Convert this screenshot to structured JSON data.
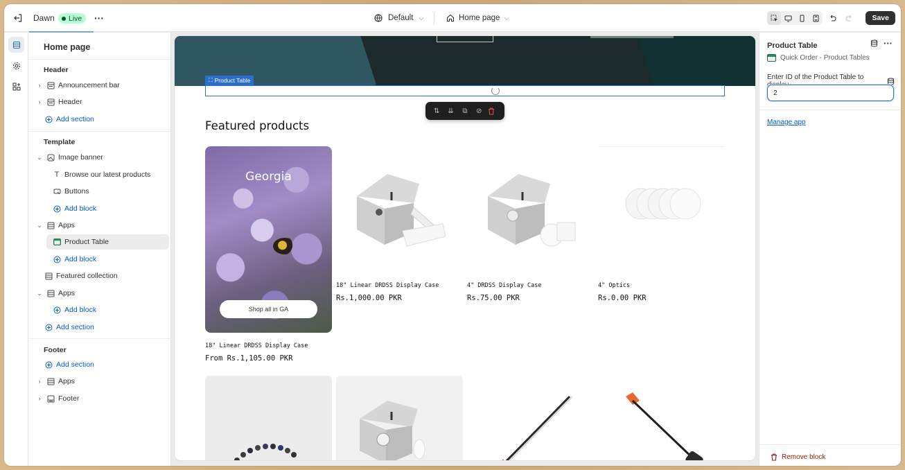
{
  "topbar": {
    "theme_name": "Dawn",
    "live_label": "Live",
    "template_label": "Default",
    "page_label": "Home page",
    "save_label": "Save"
  },
  "sidebar": {
    "title": "Home page",
    "header_group": "Header",
    "announcement_bar": "Announcement bar",
    "header_section": "Header",
    "add_section_1": "Add section",
    "template_group": "Template",
    "image_banner": "Image banner",
    "browse_block": "Browse our latest products",
    "buttons_block": "Buttons",
    "add_block_1": "Add block",
    "apps_1": "Apps",
    "product_table": "Product Table",
    "add_block_2": "Add block",
    "featured_collection": "Featured collection",
    "apps_2": "Apps",
    "add_block_3": "Add block",
    "add_section_2": "Add section",
    "footer_group": "Footer",
    "add_section_3": "Add section",
    "apps_3": "Apps",
    "footer_section": "Footer"
  },
  "preview": {
    "product_table_tag": "Product Table",
    "featured_title": "Featured products",
    "georgia_text": "Georgia",
    "shop_button": "Shop all in GA",
    "products": [
      {
        "title": "18\" Linear DRDSS Display Case",
        "price": "From Rs.1,105.00 PKR"
      },
      {
        "title": "18\" Linear DRDSS Display Case",
        "price": "Rs.1,000.00 PKR"
      },
      {
        "title": "4\" DRDSS Display Case",
        "price": "Rs.75.00 PKR"
      },
      {
        "title": "4\" Optics",
        "price": "Rs.0.00 PKR"
      }
    ]
  },
  "rpanel": {
    "title": "Product Table",
    "app_name": "Quick Order - Product Tables",
    "field_label": "Enter ID of the Product Table to display",
    "field_value": "2",
    "manage_app": "Manage app",
    "remove_block": "Remove block"
  },
  "colors": {
    "accent": "#2c6ecb",
    "link": "#005bd3",
    "live_badge": "#b4fed2",
    "danger": "#e34d4d"
  }
}
